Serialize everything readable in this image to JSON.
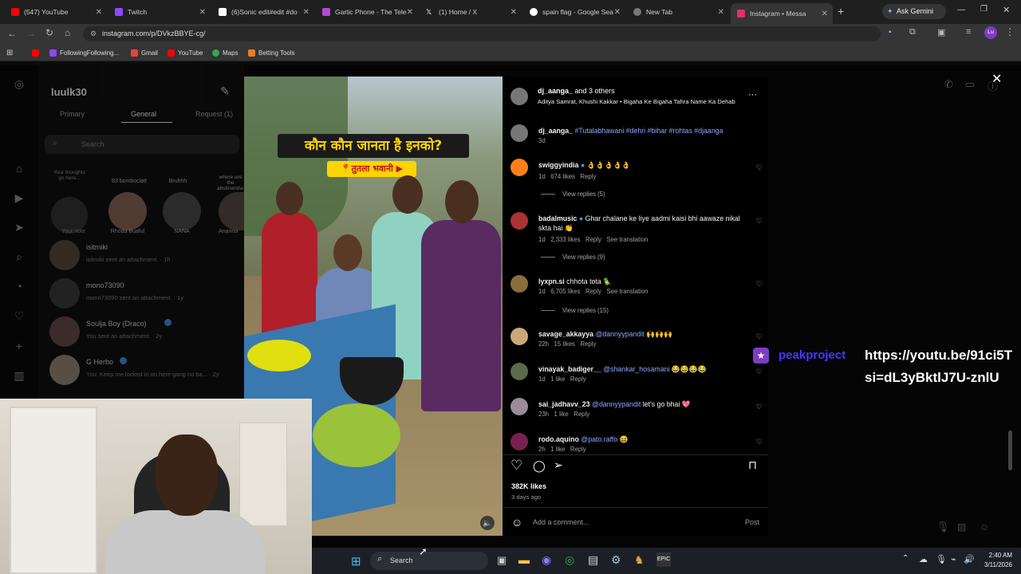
{
  "browser": {
    "tabs": [
      {
        "label": "(547) YouTube",
        "color": "#ff0000"
      },
      {
        "label": "Twitch",
        "color": "#9146ff"
      },
      {
        "label": "(6)Sonic edit#edit #do",
        "color": "#ffffff"
      },
      {
        "label": "Gartic Phone - The Tele",
        "color": "#b04bd6"
      },
      {
        "label": "(1) Home / X",
        "color": "#ffffff"
      },
      {
        "label": "spain flag - Google Sea",
        "color": "#4285f4"
      },
      {
        "label": "New Tab",
        "color": "#aaaaaa"
      },
      {
        "label": "Instagram • Messa",
        "color": "#e1306c"
      }
    ],
    "ask_gemini": "Ask Gemini",
    "url": "instagram.com/p/DVkzBBYE-cg/",
    "profile_initials": "Lu",
    "bookmarks": [
      "FollowingFollowing...",
      "Gmail",
      "YouTube",
      "Maps",
      "Betting Tools"
    ]
  },
  "dm": {
    "username": "luulk30",
    "tabs": [
      "Primary",
      "General",
      "Request (1)"
    ],
    "search_placeholder": "Search",
    "notes": [
      {
        "note": "Your thoughts go here...",
        "name": "Your note"
      },
      {
        "note": "83 bomboclatt",
        "name": "Rhoda Buaful"
      },
      {
        "note": "Bruhhh",
        "name": "NANA"
      },
      {
        "note": "where are the abstinent/w...",
        "name": "Arianna"
      }
    ],
    "threads": [
      {
        "name": "isitmiki",
        "sub": "isitmiki sent an attachment. · 1h"
      },
      {
        "name": "mono73090",
        "sub": "mono73090 sent an attachment. · 1y"
      },
      {
        "name": "Soulja Boy (Draco)",
        "sub": "You sent an attachment. · 2y"
      },
      {
        "name": "G Herbo",
        "sub": "You: Keep me locked in on here gang no ba... · 2y"
      }
    ]
  },
  "post": {
    "caption_overlay": "कौन कौन जानता है इनको?",
    "location_tag": "📍तुतला भवानी ▶",
    "header_user": "dj_aanga_",
    "header_others": " and 3 others",
    "header_sub": "Aditya Samrat, Khushi Kakkar • Bigaha Ke Bigaha Tahra Name Ka Dehab",
    "caption_user": "dj_aanga_",
    "caption_tags": "#Tutalabhawani #dehri #bihar #rohtas #djaanga",
    "caption_age": "3d",
    "comments": [
      {
        "user": "swiggyindia",
        "verified": true,
        "mention": "",
        "text": "👌👌👌👌👌",
        "age": "1d",
        "likes": "674 likes",
        "translate": "",
        "replies": "View replies (5)",
        "avatar_color": "#fc8019"
      },
      {
        "user": "badalmusic",
        "verified": true,
        "mention": "",
        "text": "Ghar chalane ke liye aadmi kaisi bhi aawaze nikal skta hai 👏",
        "age": "1d",
        "likes": "2,333 likes",
        "translate": "See translation",
        "replies": "View replies (9)",
        "avatar_color": "#a33"
      },
      {
        "user": "lyxpn.si",
        "verified": false,
        "mention": "",
        "text": "chhota tota 🦜",
        "age": "1d",
        "likes": "6,705 likes",
        "translate": "See translation",
        "replies": "View replies (15)",
        "avatar_color": "#8a6d3b"
      },
      {
        "user": "savage_akkayya",
        "verified": false,
        "mention": "@dannyypandit",
        "text": "🙌🙌🙌",
        "age": "22h",
        "likes": "15 likes",
        "translate": "",
        "replies": "",
        "avatar_color": "#c9a87a"
      },
      {
        "user": "vinayak_badiger__",
        "verified": false,
        "mention": "@shankar_hosamani",
        "text": "😂😂😂😂",
        "age": "1d",
        "likes": "1 like",
        "translate": "",
        "replies": "",
        "avatar_color": "#5a6a4a"
      },
      {
        "user": "sai_jadhavv_23",
        "verified": false,
        "mention": "@dannyypandit",
        "text": "let's go bhai 💖",
        "age": "23h",
        "likes": "1 like",
        "translate": "",
        "replies": "",
        "avatar_color": "#9a8a9a"
      },
      {
        "user": "rodo.aquino",
        "verified": false,
        "mention": "@pato.raffo",
        "text": "😆",
        "age": "2h",
        "likes": "1 like",
        "translate": "",
        "replies": "",
        "avatar_color": "#7a2050"
      }
    ],
    "reply_label": "Reply",
    "likes_total": "382K likes",
    "posted": "3 days ago",
    "comment_placeholder": "Add a comment...",
    "post_label": "Post"
  },
  "overlay": {
    "channel": "peakproject",
    "link_line1": "https://youtu.be/91ci5T",
    "link_line2": "si=dL3yBktlJ7U-znlU"
  },
  "taskbar": {
    "search_label": "Search",
    "time": "2:40 AM",
    "date": "3/11/2026"
  }
}
